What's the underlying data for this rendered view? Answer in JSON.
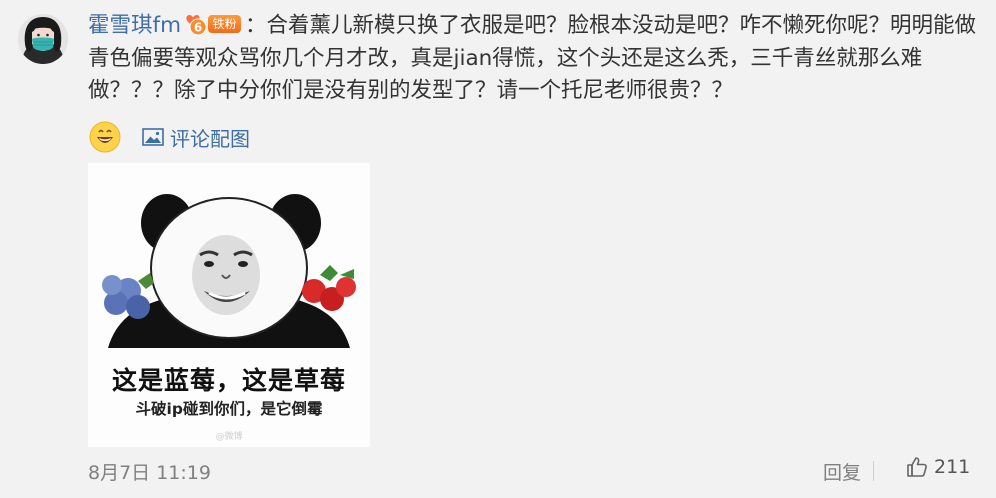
{
  "comment": {
    "username": "霍雪琪fm",
    "badge_level": "6",
    "badge_label": "铁粉",
    "colon": "：",
    "text": "合着薰儿新模只换了衣服是吧？脸根本没动是吧？咋不懒死你呢？明明能做青色偏要等观众骂你几个月才改，真是jian得慌，这个头还是这么秃，三千青丝就那么难做？？？除了中分你们是没有别的发型了？请一个托尼老师很贵？？"
  },
  "toolbar": {
    "emoji_icon": "smiley-face-icon",
    "image_comment_icon": "image-icon",
    "image_comment_label": "评论配图"
  },
  "meme_image": {
    "caption_main": "这是蓝莓，这是草莓",
    "caption_sub": "斗破ip碰到你们，是它倒霉",
    "watermark": "@微博"
  },
  "footer": {
    "timestamp": "8月7日 11:19",
    "reply_label": "回复",
    "like_icon": "thumbs-up-icon",
    "like_count": "211"
  },
  "colors": {
    "background": "#f2f2f2",
    "link_blue": "#3f6ea6",
    "badge_orange": "#f26a1b",
    "meta_gray": "#808080"
  }
}
